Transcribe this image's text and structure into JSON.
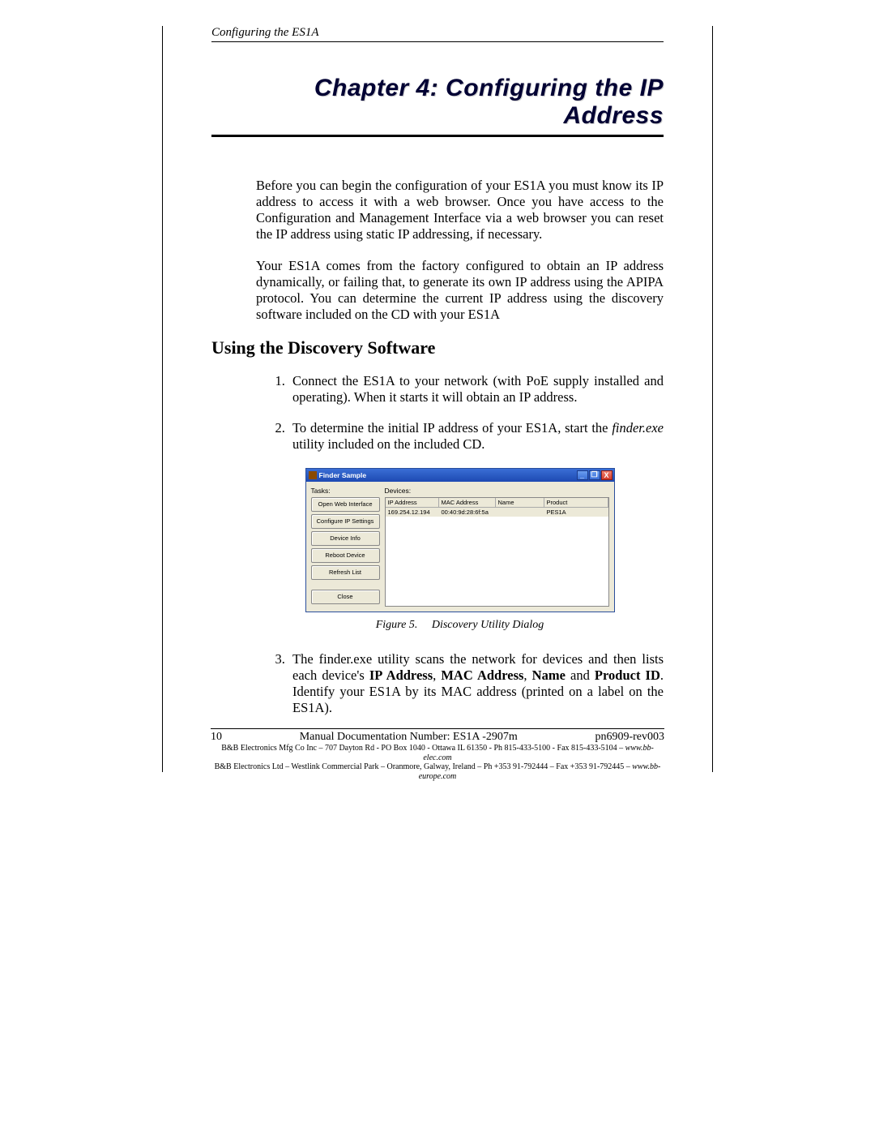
{
  "header": {
    "running": "Configuring the ES1A"
  },
  "chapter": {
    "title": "Chapter 4:  Configuring the IP Address"
  },
  "intro": {
    "p1": "Before you can begin the configuration of your ES1A you must know its IP address to access it with a web browser. Once you have access to the Configuration and Management Interface via a web browser you can reset the IP address using static IP addressing, if necessary.",
    "p2": "Your ES1A comes from the factory configured to obtain an IP address dynamically, or failing that, to generate its own IP address using the APIPA protocol. You can determine the current IP address using the discovery software included on the CD with your ES1A"
  },
  "section": {
    "heading": "Using the Discovery Software"
  },
  "steps": {
    "s1": "Connect the ES1A to your network (with PoE supply installed and operating). When it starts it will obtain an IP address.",
    "s2_a": "To determine the initial IP address of your ES1A, start the ",
    "s2_em": "finder.exe",
    "s2_b": " utility included on the included CD.",
    "s3_a": "The finder.exe utility scans the network for devices and then lists each device's ",
    "s3_b1": "IP Address",
    "s3_c1": ", ",
    "s3_b2": "MAC Address",
    "s3_c2": ", ",
    "s3_b3": "Name",
    "s3_c3": " and ",
    "s3_b4": "Product ID",
    "s3_d": ". Identify your ES1A by its MAC address (printed on a label on the ES1A)."
  },
  "figure": {
    "caption_label": "Figure 5.",
    "caption_text": "Discovery Utility Dialog"
  },
  "app": {
    "title": "Finder Sample",
    "labels": {
      "tasks": "Tasks:",
      "devices": "Devices:"
    },
    "buttons": {
      "open": "Open Web Interface",
      "config": "Configure IP Settings",
      "info": "Device Info",
      "reboot": "Reboot Device",
      "refresh": "Refresh List",
      "close": "Close"
    },
    "win": {
      "min": "_",
      "max": "❐",
      "close": "X"
    },
    "columns": {
      "ip": "IP Address",
      "mac": "MAC Address",
      "name": "Name",
      "product": "Product"
    },
    "row": {
      "ip": "169.254.12.194",
      "mac": "00:40:9d:28:6f:5a",
      "name": "",
      "product": "PES1A"
    }
  },
  "footer": {
    "page": "10",
    "mid": "Manual Documentation Number:  ES1A -2907m",
    "rev": "pn6909-rev003",
    "line2a": "B&B Electronics Mfg Co Inc – 707 Dayton Rd - PO Box 1040 - Ottawa IL 61350 - Ph 815-433-5100 - Fax 815-433-5104 – ",
    "line2url": "www.bb-elec.com",
    "line3a": "B&B Electronics Ltd – Westlink Commercial Park – Oranmore, Galway, Ireland – Ph +353 91-792444 – Fax +353 91-792445 – ",
    "line3url": "www.bb-europe.com"
  }
}
